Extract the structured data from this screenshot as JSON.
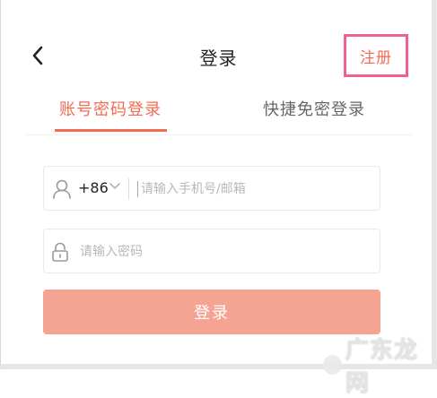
{
  "header": {
    "title": "登录",
    "register_label": "注册",
    "back_icon": "chevron-left-icon"
  },
  "tabs": [
    {
      "label": "账号密码登录",
      "active": true
    },
    {
      "label": "快捷免密登录",
      "active": false
    }
  ],
  "form": {
    "country_code": "+86",
    "phone_placeholder": "请输入手机号/邮箱",
    "phone_value": "",
    "password_placeholder": "请输入密码",
    "password_value": "",
    "submit_label": "登录"
  },
  "colors": {
    "accent": "#f26b52",
    "button": "#f5a392",
    "highlight": "#ef5f95"
  },
  "watermark": {
    "text": "广东龙网"
  }
}
